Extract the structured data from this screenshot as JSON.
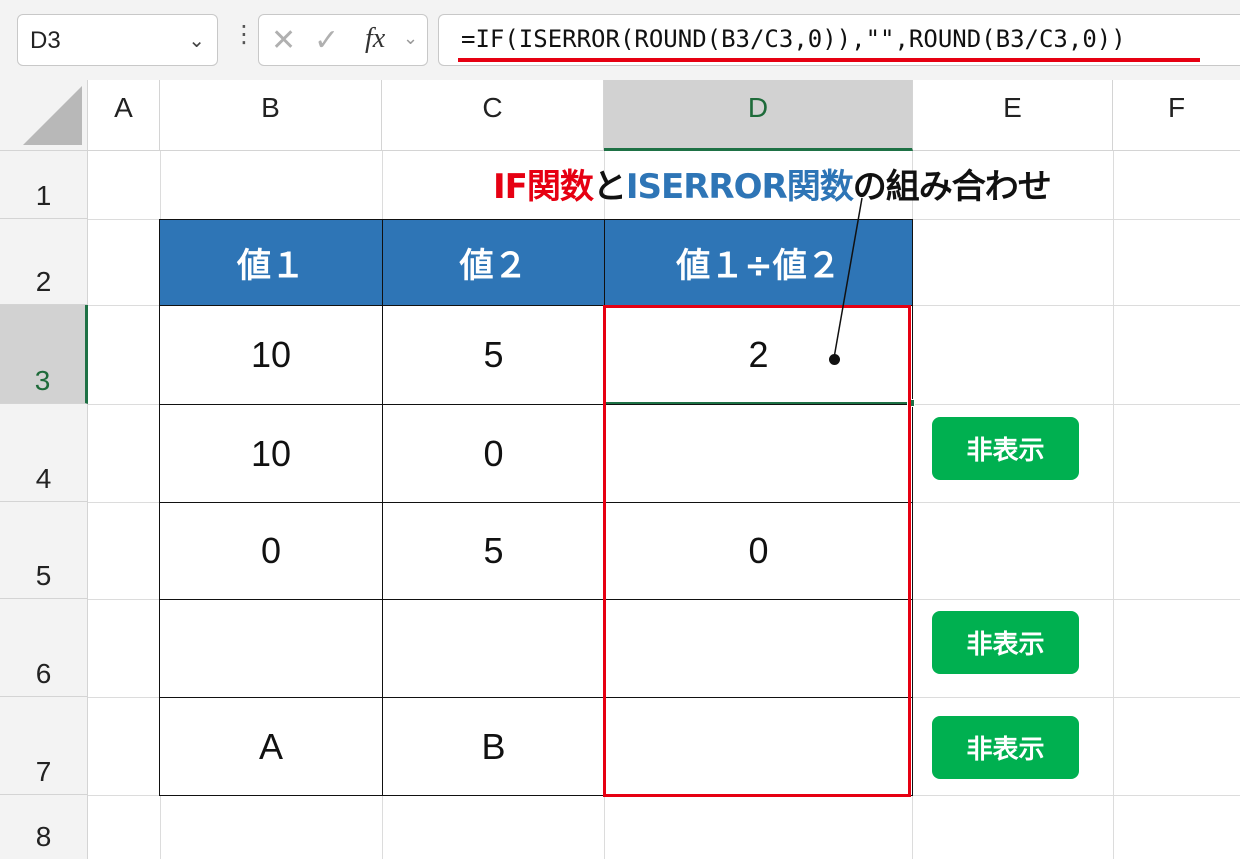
{
  "formula_bar": {
    "name_box": "D3",
    "cancel_icon": "✕",
    "enter_icon": "✓",
    "fx_label": "fx",
    "formula": "=IF(ISERROR(ROUND(B3/C3,0)),\"\",ROUND(B3/C3,0))"
  },
  "columns": [
    "A",
    "B",
    "C",
    "D",
    "E",
    "F"
  ],
  "rows": [
    "1",
    "2",
    "3",
    "4",
    "5",
    "6",
    "7",
    "8"
  ],
  "active_cell": "D3",
  "title": {
    "part1": "IF関数",
    "part2": "と",
    "part3": "ISERROR関数",
    "part4": "の組み合わせ"
  },
  "table": {
    "headers": [
      "値１",
      "値２",
      "値１÷値２"
    ],
    "rows": [
      [
        "10",
        "5",
        "2"
      ],
      [
        "10",
        "0",
        ""
      ],
      [
        "0",
        "5",
        "0"
      ],
      [
        "",
        "",
        ""
      ],
      [
        "A",
        "B",
        ""
      ]
    ]
  },
  "badges": {
    "row4": "非表示",
    "row6": "非表示",
    "row7": "非表示"
  },
  "colors": {
    "header_bg": "#2e75b6",
    "highlight": "#e60012",
    "badge": "#00b050",
    "excel_green": "#1e7145"
  }
}
